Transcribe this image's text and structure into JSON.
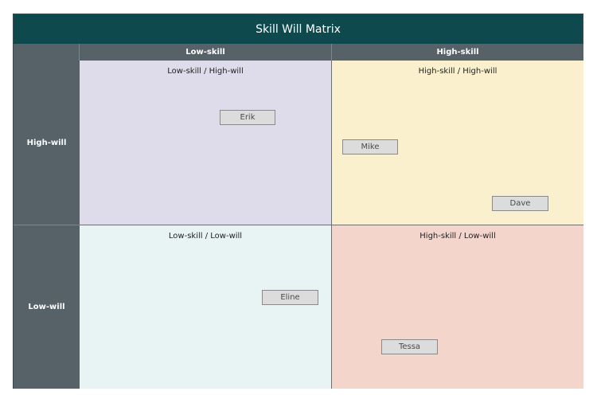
{
  "title": "Skill Will Matrix",
  "columns": [
    {
      "label": "Low-skill"
    },
    {
      "label": "High-skill"
    }
  ],
  "rows": [
    {
      "label": "High-will"
    },
    {
      "label": "Low-will"
    }
  ],
  "quadrants": {
    "low_skill_high_will": {
      "title": "Low-skill / High-will",
      "color": "#dedbea"
    },
    "high_skill_high_will": {
      "title": "High-skill / High-will",
      "color": "#faf0cd"
    },
    "low_skill_low_will": {
      "title": "Low-skill / Low-will",
      "color": "#e7f4f3"
    },
    "high_skill_low_will": {
      "title": "High-skill / Low-will",
      "color": "#f3d5cb"
    }
  },
  "people": {
    "erik": "Erik",
    "mike": "Mike",
    "dave": "Dave",
    "eline": "Eline",
    "tessa": "Tessa"
  }
}
